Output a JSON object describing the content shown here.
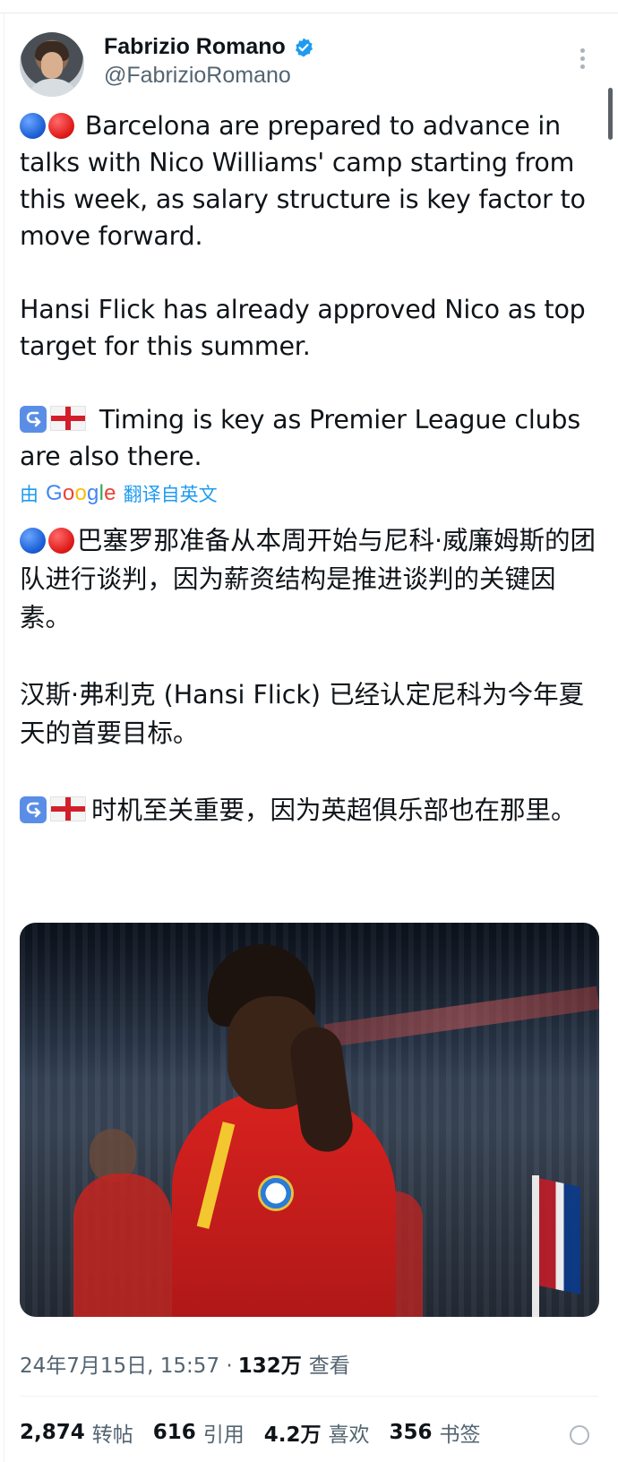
{
  "author": {
    "display_name": "Fabrizio Romano",
    "handle": "@FabrizioRomano"
  },
  "tweet": {
    "line1": " Barcelona are prepared to advance in talks with Nico Williams' camp starting from this week, as salary structure is key factor to move forward.",
    "line2": "Hansi Flick has already approved Nico as top target for this summer.",
    "line3": " Timing is key as Premier League clubs are also there."
  },
  "translation": {
    "prefix": "由",
    "google_letters": [
      "G",
      "o",
      "o",
      "g",
      "l",
      "e"
    ],
    "suffix": "翻译自英文"
  },
  "translated": {
    "line1": "巴塞罗那准备从本周开始与尼科·威廉姆斯的团队进行谈判，因为薪资结构是推进谈判的关键因素。",
    "line2": "汉斯·弗利克 (Hansi Flick) 已经认定尼科为今年夏天的首要目标。",
    "line3": "时机至关重要，因为英超俱乐部也在那里。"
  },
  "meta": {
    "timestamp": "24年7月15日, 15:57 ·",
    "views_count": "132万",
    "views_label": "查看"
  },
  "stats": {
    "retweets_count": "2,874",
    "retweets_label": "转帖",
    "quotes_count": "616",
    "quotes_label": "引用",
    "likes_count": "4.2万",
    "likes_label": "喜欢",
    "bookmarks_count": "356",
    "bookmarks_label": "书签"
  },
  "colors": {
    "link_blue": "#1d9bf0",
    "secondary_text": "#536471",
    "primary_text": "#0f1419",
    "verified_blue": "#1d9bf0"
  },
  "icons": {
    "verified": "verified-badge-icon",
    "more": "more-options-icon",
    "emoji_blue": "blue-circle-emoji",
    "emoji_red": "red-circle-emoji",
    "emoji_arrow": "right-arrow-curving-left-emoji",
    "emoji_flag": "england-flag-emoji"
  }
}
